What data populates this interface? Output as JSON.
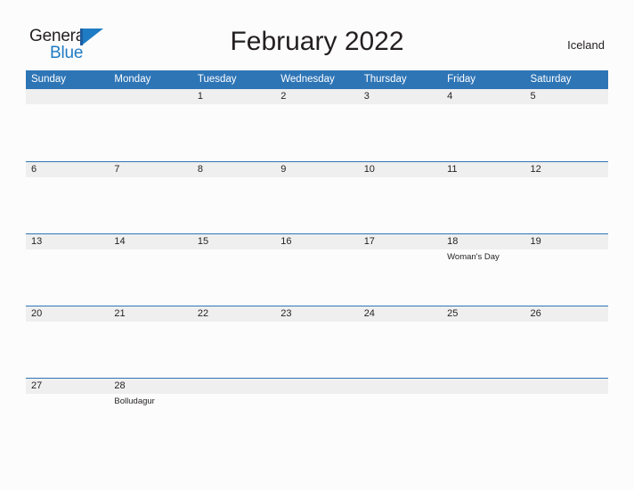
{
  "logo": {
    "text_top": "General",
    "text_bottom": "Blue",
    "icon": "blue-flag-triangle",
    "color_top": "#231f20",
    "color_bottom": "#1f7cc4"
  },
  "header": {
    "title": "February 2022",
    "country": "Iceland"
  },
  "theme": {
    "header_blue": "#2e75b6",
    "band_gray": "#efefef",
    "page_background": "#fcfcfc",
    "text": "#231f20"
  },
  "calendar": {
    "weekday_headers": [
      "Sunday",
      "Monday",
      "Tuesday",
      "Wednesday",
      "Thursday",
      "Friday",
      "Saturday"
    ],
    "weeks": [
      [
        {
          "day": "",
          "event": ""
        },
        {
          "day": "",
          "event": ""
        },
        {
          "day": "1",
          "event": ""
        },
        {
          "day": "2",
          "event": ""
        },
        {
          "day": "3",
          "event": ""
        },
        {
          "day": "4",
          "event": ""
        },
        {
          "day": "5",
          "event": ""
        }
      ],
      [
        {
          "day": "6",
          "event": ""
        },
        {
          "day": "7",
          "event": ""
        },
        {
          "day": "8",
          "event": ""
        },
        {
          "day": "9",
          "event": ""
        },
        {
          "day": "10",
          "event": ""
        },
        {
          "day": "11",
          "event": ""
        },
        {
          "day": "12",
          "event": ""
        }
      ],
      [
        {
          "day": "13",
          "event": ""
        },
        {
          "day": "14",
          "event": ""
        },
        {
          "day": "15",
          "event": ""
        },
        {
          "day": "16",
          "event": ""
        },
        {
          "day": "17",
          "event": ""
        },
        {
          "day": "18",
          "event": "Woman's Day"
        },
        {
          "day": "19",
          "event": ""
        }
      ],
      [
        {
          "day": "20",
          "event": ""
        },
        {
          "day": "21",
          "event": ""
        },
        {
          "day": "22",
          "event": ""
        },
        {
          "day": "23",
          "event": ""
        },
        {
          "day": "24",
          "event": ""
        },
        {
          "day": "25",
          "event": ""
        },
        {
          "day": "26",
          "event": ""
        }
      ],
      [
        {
          "day": "27",
          "event": ""
        },
        {
          "day": "28",
          "event": "Bolludagur"
        },
        {
          "day": "",
          "event": ""
        },
        {
          "day": "",
          "event": ""
        },
        {
          "day": "",
          "event": ""
        },
        {
          "day": "",
          "event": ""
        },
        {
          "day": "",
          "event": ""
        }
      ]
    ]
  }
}
